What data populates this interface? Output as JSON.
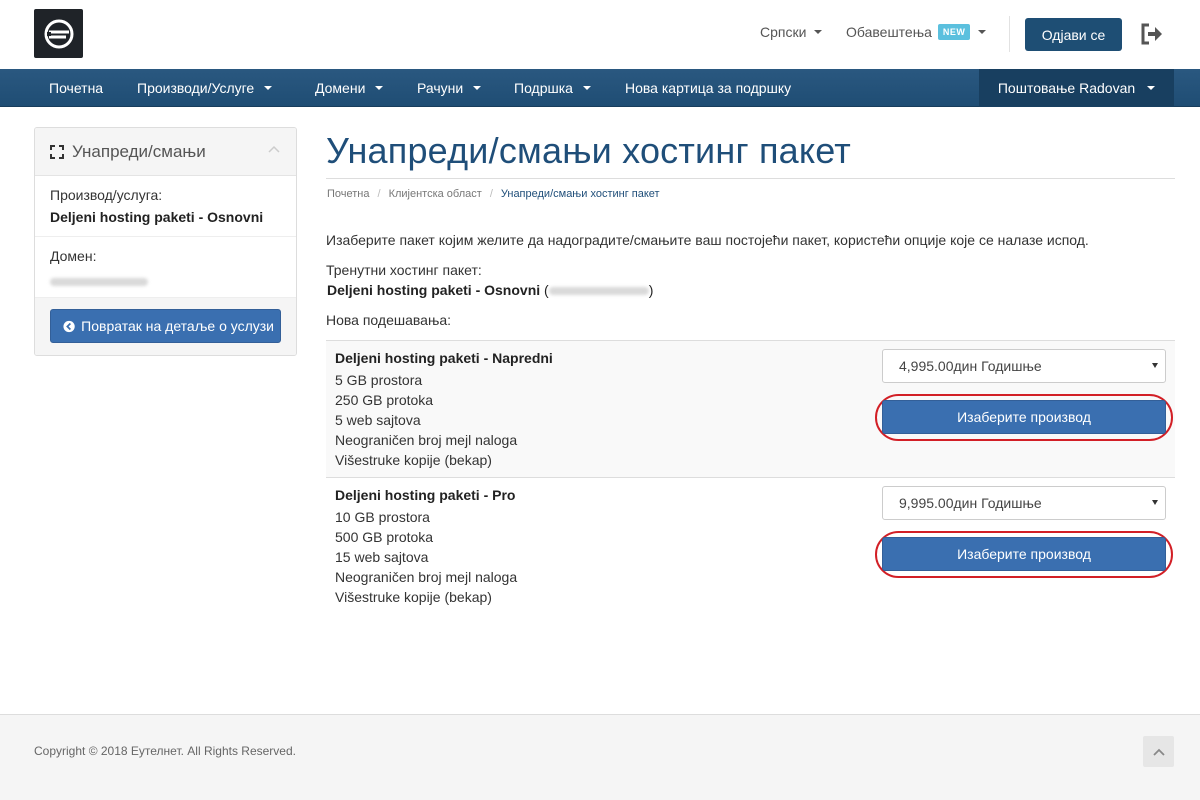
{
  "header": {
    "language_label": "Српски",
    "notifications_label": "Обавештења",
    "new_badge": "NEW",
    "logout_label": "Одјави се"
  },
  "nav": {
    "items": [
      {
        "label": "Почетна",
        "has_dropdown": false
      },
      {
        "label": "Производи/Услуге",
        "has_dropdown": true
      },
      {
        "label": "Домени",
        "has_dropdown": true
      },
      {
        "label": "Рачуни",
        "has_dropdown": true
      },
      {
        "label": "Подршка",
        "has_dropdown": true
      },
      {
        "label": "Нова картица за подршку",
        "has_dropdown": false
      }
    ],
    "account_label": "Поштовање Radovan"
  },
  "sidebar": {
    "title": "Унапреди/смањи",
    "product_label": "Производ/услуга:",
    "product_value": "Deljeni hosting paketi - Osnovni",
    "domain_label": "Домен:",
    "back_button": "Повратак на детаље о услузи"
  },
  "main": {
    "title": "Унапреди/смањи хостинг пакет",
    "breadcrumb": [
      "Почетна",
      "Клијентска област",
      "Унапреди/смањи хостинг пакет"
    ],
    "intro": "Изаберите пакет којим желите да надоградите/смањите ваш постојећи пакет, користећи опције које се налазе испод.",
    "current_label": "Тренутни хостинг пакет:",
    "current_value": "Deljeni hosting paketi - Osnovni",
    "new_settings_label": "Нова подешавања:",
    "packages": [
      {
        "name": "Deljeni hosting paketi - Napredni",
        "features": [
          "5 GB prostora",
          "250 GB protoka",
          "5 web sajtova",
          "Neograničen broj mejl naloga",
          "Višestruke kopije (bekap)"
        ],
        "cycle": "4,995.00дин Годишње",
        "button": "Изаберите производ"
      },
      {
        "name": "Deljeni hosting paketi - Pro",
        "features": [
          "10 GB prostora",
          "500 GB protoka",
          "15 web sajtova",
          "Neograničen broj mejl naloga",
          "Višestruke kopije (bekap)"
        ],
        "cycle": "9,995.00дин Годишње",
        "button": "Изаберите производ"
      }
    ]
  },
  "footer": {
    "copyright": "Copyright © 2018 Еутелнет. All Rights Reserved."
  },
  "colors": {
    "brand_blue": "#1f4e79",
    "nav_blue": "#245479",
    "button_blue": "#3a6fb0",
    "highlight_red": "#d21f26",
    "badge_cyan": "#5bc0de"
  },
  "icons": {
    "logo": "eutelnet-logo",
    "logout": "sign-out-icon",
    "sidebar": "expand-icon",
    "back": "arrow-circle-left-icon",
    "scroll_top": "chevron-up-icon"
  }
}
